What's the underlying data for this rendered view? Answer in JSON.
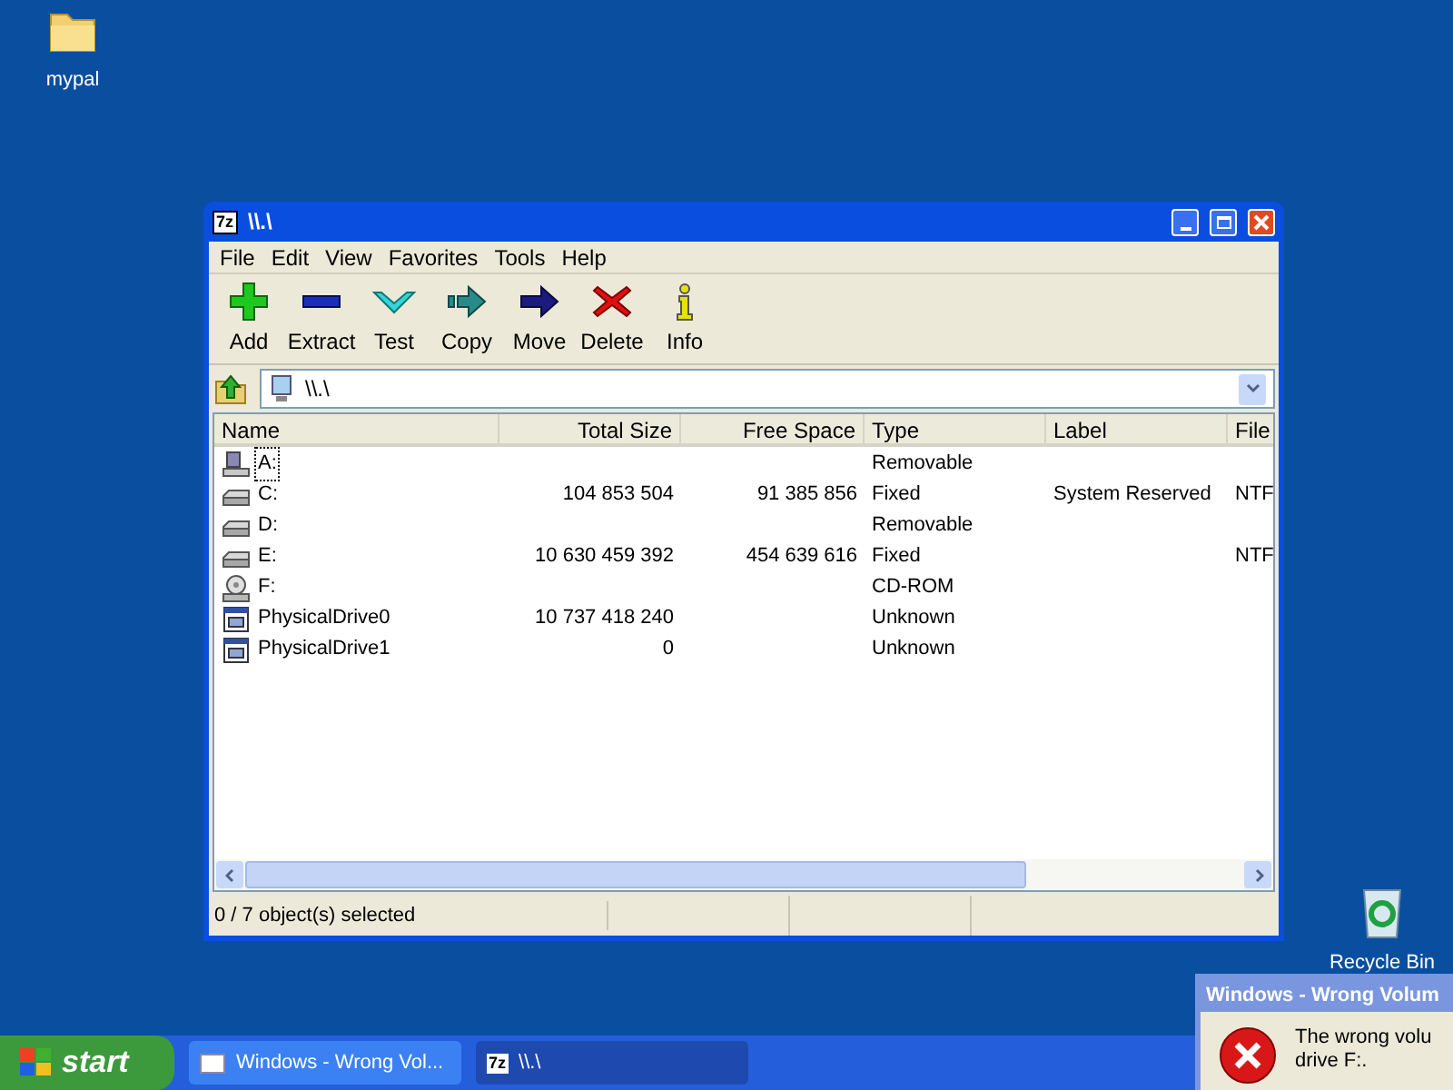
{
  "desktop_icons": [
    {
      "label": "mypal",
      "kind": "folder"
    },
    {
      "label": "Recycle Bin",
      "kind": "recycle"
    }
  ],
  "window": {
    "title": "\\\\.\\",
    "app_badge": "7z",
    "menu": [
      "File",
      "Edit",
      "View",
      "Favorites",
      "Tools",
      "Help"
    ],
    "toolbar": [
      {
        "label": "Add",
        "kind": "add"
      },
      {
        "label": "Extract",
        "kind": "extract"
      },
      {
        "label": "Test",
        "kind": "test"
      },
      {
        "label": "Copy",
        "kind": "copy"
      },
      {
        "label": "Move",
        "kind": "move"
      },
      {
        "label": "Delete",
        "kind": "delete"
      },
      {
        "label": "Info",
        "kind": "info"
      }
    ],
    "address": "\\\\.\\",
    "columns": [
      "Name",
      "Total Size",
      "Free Space",
      "Type",
      "Label",
      "File"
    ],
    "rows": [
      {
        "name": "A:",
        "total_size": "",
        "free_space": "",
        "type": "Removable",
        "label": "",
        "file_system": "",
        "kind": "floppy",
        "focused": true
      },
      {
        "name": "C:",
        "total_size": "104 853 504",
        "free_space": "91 385 856",
        "type": "Fixed",
        "label": "System Reserved",
        "file_system": "NTF",
        "kind": "hdd",
        "focused": false
      },
      {
        "name": "D:",
        "total_size": "",
        "free_space": "",
        "type": "Removable",
        "label": "",
        "file_system": "",
        "kind": "hdd",
        "focused": false
      },
      {
        "name": "E:",
        "total_size": "10 630 459 392",
        "free_space": "454 639 616",
        "type": "Fixed",
        "label": "",
        "file_system": "NTF",
        "kind": "hdd",
        "focused": false
      },
      {
        "name": "F:",
        "total_size": "",
        "free_space": "",
        "type": "CD-ROM",
        "label": "",
        "file_system": "",
        "kind": "cdrom",
        "focused": false
      },
      {
        "name": "PhysicalDrive0",
        "total_size": "10 737 418 240",
        "free_space": "",
        "type": "Unknown",
        "label": "",
        "file_system": "",
        "kind": "physical",
        "focused": false
      },
      {
        "name": "PhysicalDrive1",
        "total_size": "0",
        "free_space": "",
        "type": "Unknown",
        "label": "",
        "file_system": "",
        "kind": "physical",
        "focused": false
      }
    ],
    "status": "0 / 7 object(s) selected"
  },
  "taskbar": {
    "start": "start",
    "buttons": [
      {
        "label": "Windows - Wrong Vol...",
        "kind": "window",
        "selected": false
      },
      {
        "label": "\\\\.\\",
        "kind": "7z",
        "selected": true
      }
    ]
  },
  "dialog": {
    "title": "Windows - Wrong Volum",
    "message": "The wrong volu",
    "message_2": "drive F:."
  }
}
